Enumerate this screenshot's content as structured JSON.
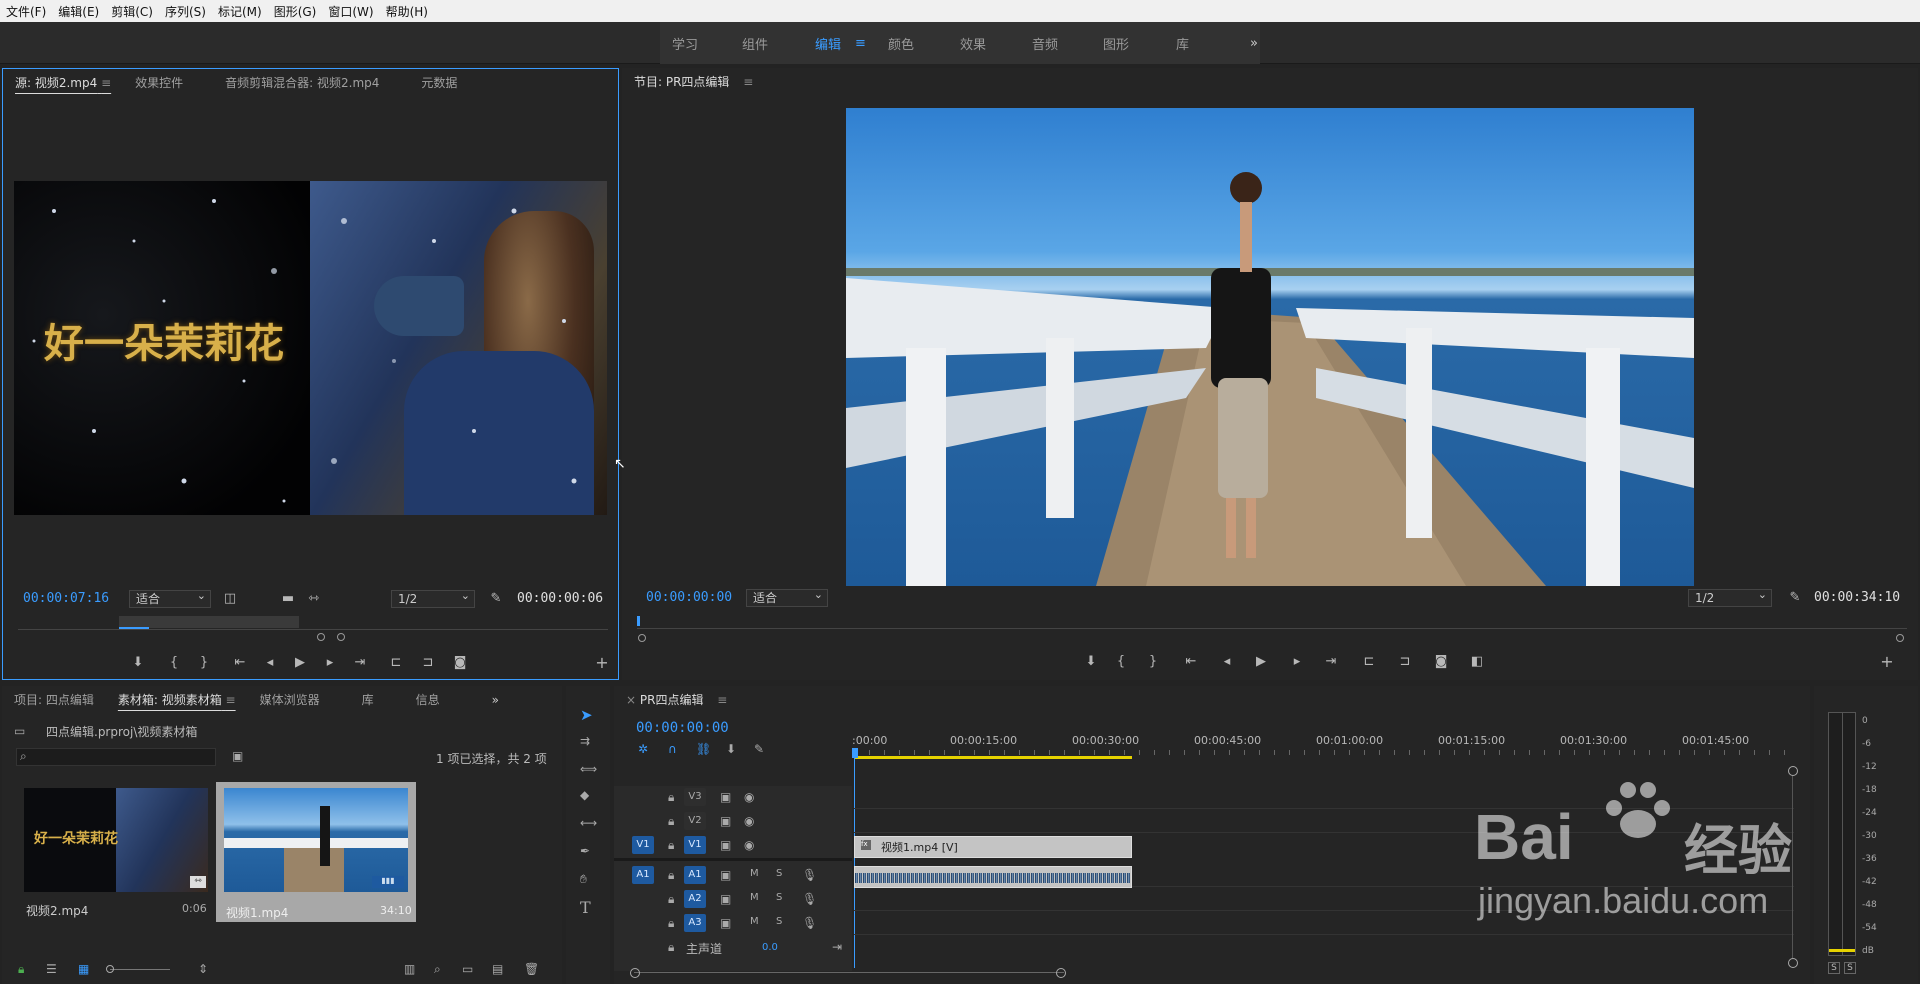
{
  "menu": [
    "文件(F)",
    "编辑(E)",
    "剪辑(C)",
    "序列(S)",
    "标记(M)",
    "图形(G)",
    "窗口(W)",
    "帮助(H)"
  ],
  "workspaces": [
    "学习",
    "组件",
    "编辑",
    "颜色",
    "效果",
    "音频",
    "图形",
    "库"
  ],
  "workspace_more": "»",
  "source": {
    "tabs": [
      "源: 视频2.mp4",
      "效果控件",
      "音频剪辑混合器: 视频2.mp4",
      "元数据"
    ],
    "overlay_title": "好一朵茉莉花",
    "timecode": "00:00:07:16",
    "fit": "适合",
    "resolution": "1/2",
    "duration": "00:00:00:06"
  },
  "program": {
    "tab": "节目: PR四点编辑",
    "timecode": "00:00:00:00",
    "fit": "适合",
    "resolution": "1/2",
    "duration": "00:00:34:10"
  },
  "project": {
    "tabs": [
      "项目: 四点编辑",
      "素材箱: 视频素材箱",
      "媒体浏览器",
      "库",
      "信息"
    ],
    "path": "四点编辑.prproj\\视频素材箱",
    "selection": "1 项已选择，共 2 项",
    "items": [
      {
        "name": "视频2.mp4",
        "duration": "0:06",
        "thumb_text": "好一朵茉莉花"
      },
      {
        "name": "视频1.mp4",
        "duration": "34:10"
      }
    ]
  },
  "timeline": {
    "tab": "PR四点编辑",
    "timecode": "00:00:00:00",
    "ruler": [
      ":00:00",
      "00:00:15:00",
      "00:00:30:00",
      "00:00:45:00",
      "00:01:00:00",
      "00:01:15:00",
      "00:01:30:00",
      "00:01:45:00"
    ],
    "tracks_video": [
      "V3",
      "V2",
      "V1"
    ],
    "tracks_audio": [
      "A1",
      "A2",
      "A3"
    ],
    "source_patch_v": "V1",
    "source_patch_a": "A1",
    "master_label": "主声道",
    "master_value": "0.0",
    "clip_v_label": "视频1.mp4 [V]",
    "mute": "M",
    "solo": "S"
  },
  "meter": {
    "scale": [
      "0",
      "-6",
      "-12",
      "-18",
      "-24",
      "-30",
      "-36",
      "-42",
      "-48",
      "-54",
      "dB"
    ],
    "solo": [
      "S",
      "S"
    ]
  },
  "watermark": {
    "line1": "Bai",
    "line2": "经验",
    "url": "jingyan.baidu.com"
  },
  "colors": {
    "accent": "#3a9cff",
    "patch": "#1e5aa0",
    "work_area": "#e6d200"
  }
}
